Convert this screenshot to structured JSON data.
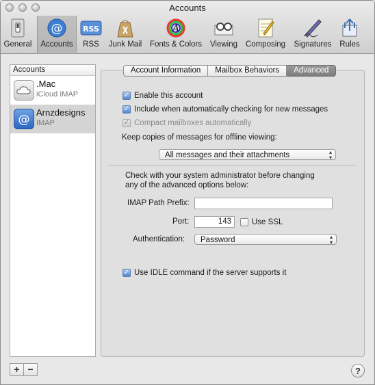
{
  "window": {
    "title": "Accounts"
  },
  "toolbar": {
    "items": [
      {
        "label": "General",
        "icon": "switch-icon"
      },
      {
        "label": "Accounts",
        "icon": "at-icon"
      },
      {
        "label": "RSS",
        "icon": "rss-icon"
      },
      {
        "label": "Junk Mail",
        "icon": "junk-bag-icon"
      },
      {
        "label": "Fonts & Colors",
        "icon": "font-colors-icon"
      },
      {
        "label": "Viewing",
        "icon": "viewing-icon"
      },
      {
        "label": "Composing",
        "icon": "composing-icon"
      },
      {
        "label": "Signatures",
        "icon": "signature-pen-icon"
      },
      {
        "label": "Rules",
        "icon": "rules-icon"
      }
    ],
    "selected": "Accounts"
  },
  "sidebar": {
    "header": "Accounts",
    "accounts": [
      {
        "name": ".Mac",
        "type": "iCloud IMAP"
      },
      {
        "name": "Arnzdesigns",
        "type": "IMAP"
      }
    ]
  },
  "buttons": {
    "add": "+",
    "remove": "−",
    "help": "?"
  },
  "tabs": [
    "Account Information",
    "Mailbox Behaviors",
    "Advanced"
  ],
  "advanced": {
    "enable_account": "Enable this account",
    "include_checking": "Include when automatically checking for new messages",
    "compact_mailboxes": "Compact mailboxes automatically",
    "keep_copies_label": "Keep copies of messages for offline viewing:",
    "keep_copies_value": "All messages and their attachments",
    "admin_note_line1": "Check with your system administrator before changing",
    "admin_note_line2": "any of the advanced options below:",
    "imap_prefix_label": "IMAP Path Prefix:",
    "imap_prefix_value": "",
    "port_label": "Port:",
    "port_value": "143",
    "use_ssl_label": "Use SSL",
    "auth_label": "Authentication:",
    "auth_value": "Password",
    "idle_label": "Use IDLE command if the server supports it"
  },
  "colors": {
    "accent": "#4d86d6",
    "tab_active": "#8a8a8a",
    "selected_row": "#d4d4d4"
  }
}
